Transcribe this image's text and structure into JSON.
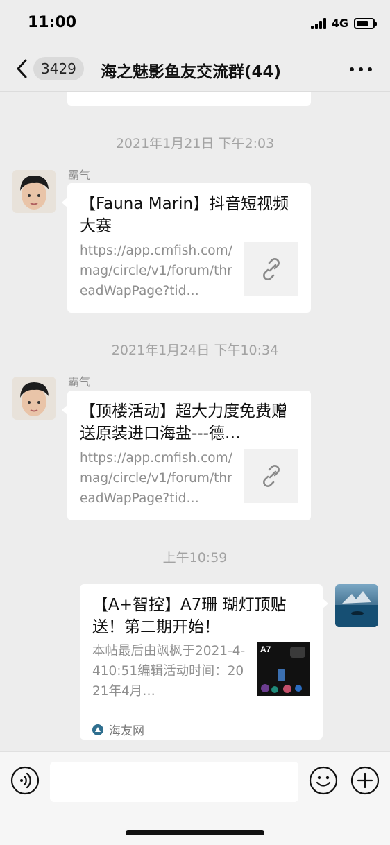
{
  "status_bar": {
    "time": "11:00",
    "network": "4G"
  },
  "nav": {
    "unread_count": "3429",
    "title": "海之魅影鱼友交流群(44)"
  },
  "messages": [
    {
      "timestamp": "2021年1月21日 下午2:03",
      "sender": "霸气",
      "title": "【Fauna Marin】抖音短视频大赛",
      "desc": "https://app.cmfish.com/mag/circle/v1/forum/threadWapPage?tid…"
    },
    {
      "timestamp": "2021年1月24日 下午10:34",
      "sender": "霸气",
      "title": "【顶楼活动】超大力度免费赠送原装进口海盐---德…",
      "desc": "https://app.cmfish.com/mag/circle/v1/forum/threadWapPage?tid…"
    },
    {
      "timestamp": "上午10:59",
      "title": "【A+智控】A7珊 瑚灯顶贴送！第二期开始！",
      "desc": "本帖最后由飒枫于2021-4-410:51编辑活动时间：2021年4月…",
      "thumb_label": "A7",
      "source": "海友网"
    }
  ],
  "icons": {
    "back": "chevron-left-icon",
    "more": "ellipsis-icon",
    "link": "link-icon",
    "voice": "voice-icon",
    "emoji": "emoji-icon",
    "plus": "plus-icon"
  },
  "colors": {
    "background": "#ededed",
    "card": "#ffffff",
    "timestamp": "#a3a3a3",
    "secondary_text": "#8f8f8f"
  }
}
